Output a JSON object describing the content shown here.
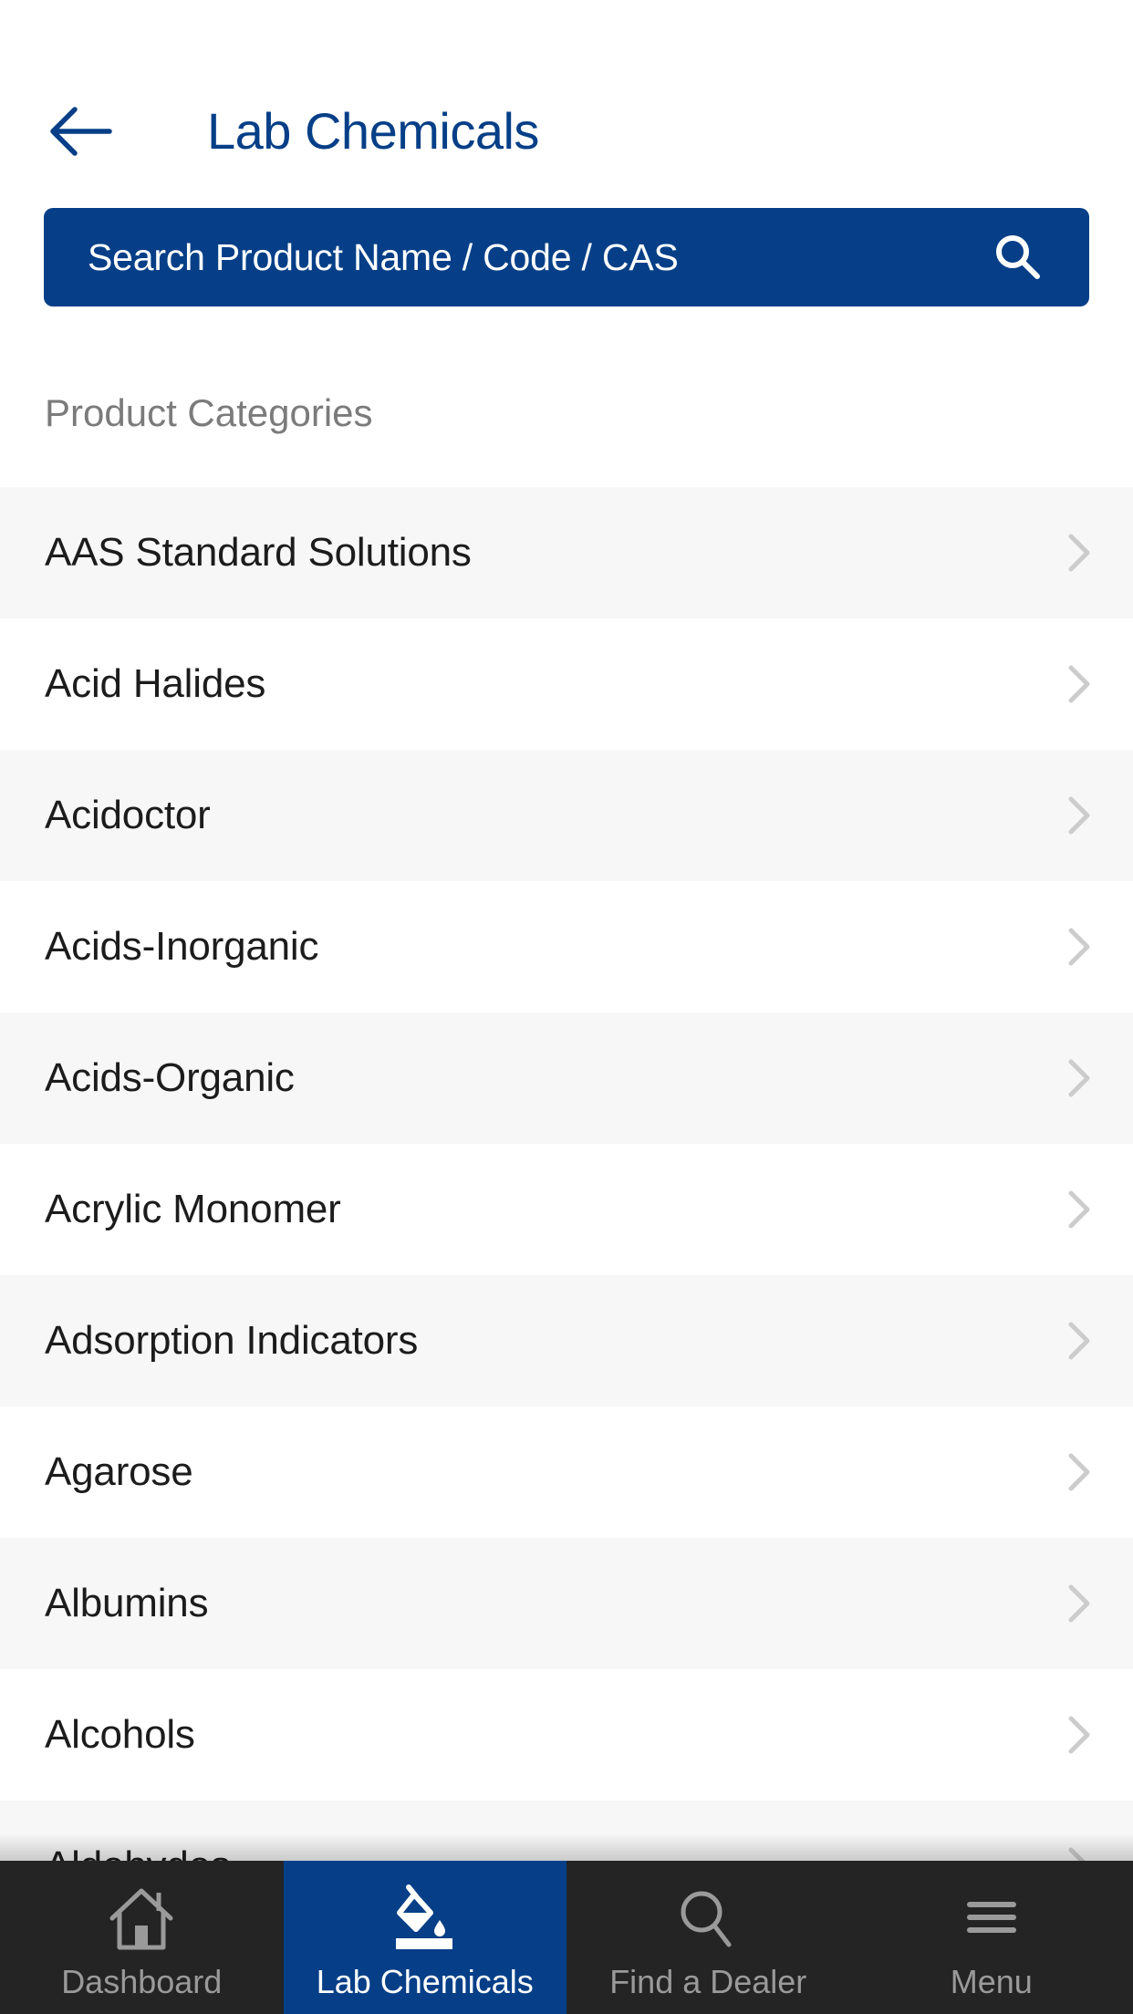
{
  "header": {
    "back_icon": "arrow-left-icon",
    "title": "Lab Chemicals"
  },
  "search": {
    "placeholder": "Search Product Name / Code / CAS",
    "value": "",
    "icon": "search-icon"
  },
  "section": {
    "label": "Product Categories"
  },
  "categories": [
    {
      "label": "AAS Standard Solutions"
    },
    {
      "label": "Acid Halides"
    },
    {
      "label": "Acidoctor"
    },
    {
      "label": "Acids-Inorganic"
    },
    {
      "label": "Acids-Organic"
    },
    {
      "label": "Acrylic Monomer"
    },
    {
      "label": "Adsorption Indicators"
    },
    {
      "label": "Agarose"
    },
    {
      "label": "Albumins"
    },
    {
      "label": "Alcohols"
    },
    {
      "label": "Aldehydes"
    }
  ],
  "tabbar": {
    "active_index": 1,
    "tabs": [
      {
        "label": "Dashboard",
        "icon": "home-icon"
      },
      {
        "label": "Lab Chemicals",
        "icon": "paint-bucket-icon"
      },
      {
        "label": "Find a Dealer",
        "icon": "search-icon"
      },
      {
        "label": "Menu",
        "icon": "hamburger-menu-icon"
      }
    ]
  },
  "colors": {
    "brand_blue": "#063f87",
    "tabbar_bg": "#242424",
    "row_alt_bg": "#f7f7f7",
    "muted_text": "#7b7b7b",
    "chevron": "#cccccc"
  }
}
